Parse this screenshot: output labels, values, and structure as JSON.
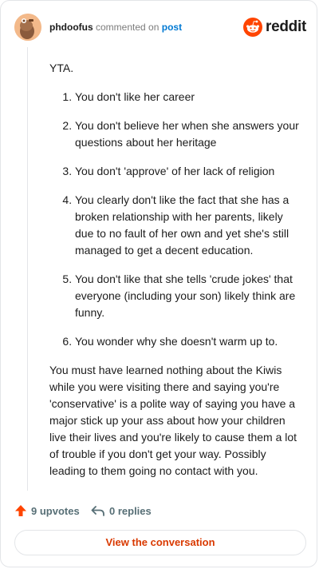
{
  "header": {
    "author": "phdoofus",
    "commented_text": "commented on",
    "post_link": "post",
    "brand": "reddit"
  },
  "comment": {
    "intro": "YTA.",
    "reasons": [
      "You don't like her career",
      "You don't believe her when she answers your questions about her heritage",
      "You don't 'approve' of her lack of religion",
      "You clearly don't like the fact that she has a broken relationship with her parents, likely due to no fault of her own and yet she's still managed to get a decent education.",
      "You don't like that she tells 'crude jokes' that everyone (including your son) likely think are funny.",
      "You wonder why she doesn't warm up to."
    ],
    "outro": "You must have learned nothing about the Kiwis while you were visiting there and saying you're 'conservative' is a polite way of saying you have a major stick up your ass about how your children live their lives and you're likely to cause them a lot of trouble if you don't get your way. Possibly leading to them going no contact with you."
  },
  "actions": {
    "upvotes": "9 upvotes",
    "replies": "0 replies"
  },
  "view_button": "View the conversation",
  "colors": {
    "accent": "#ff4500",
    "link": "#0079d3",
    "button_text": "#d93900",
    "muted": "#576f76"
  },
  "icons": {
    "avatar": "snoo-avatar",
    "brand": "reddit-logo-icon",
    "upvote": "upvote-arrow-icon",
    "reply": "reply-arrow-icon"
  }
}
